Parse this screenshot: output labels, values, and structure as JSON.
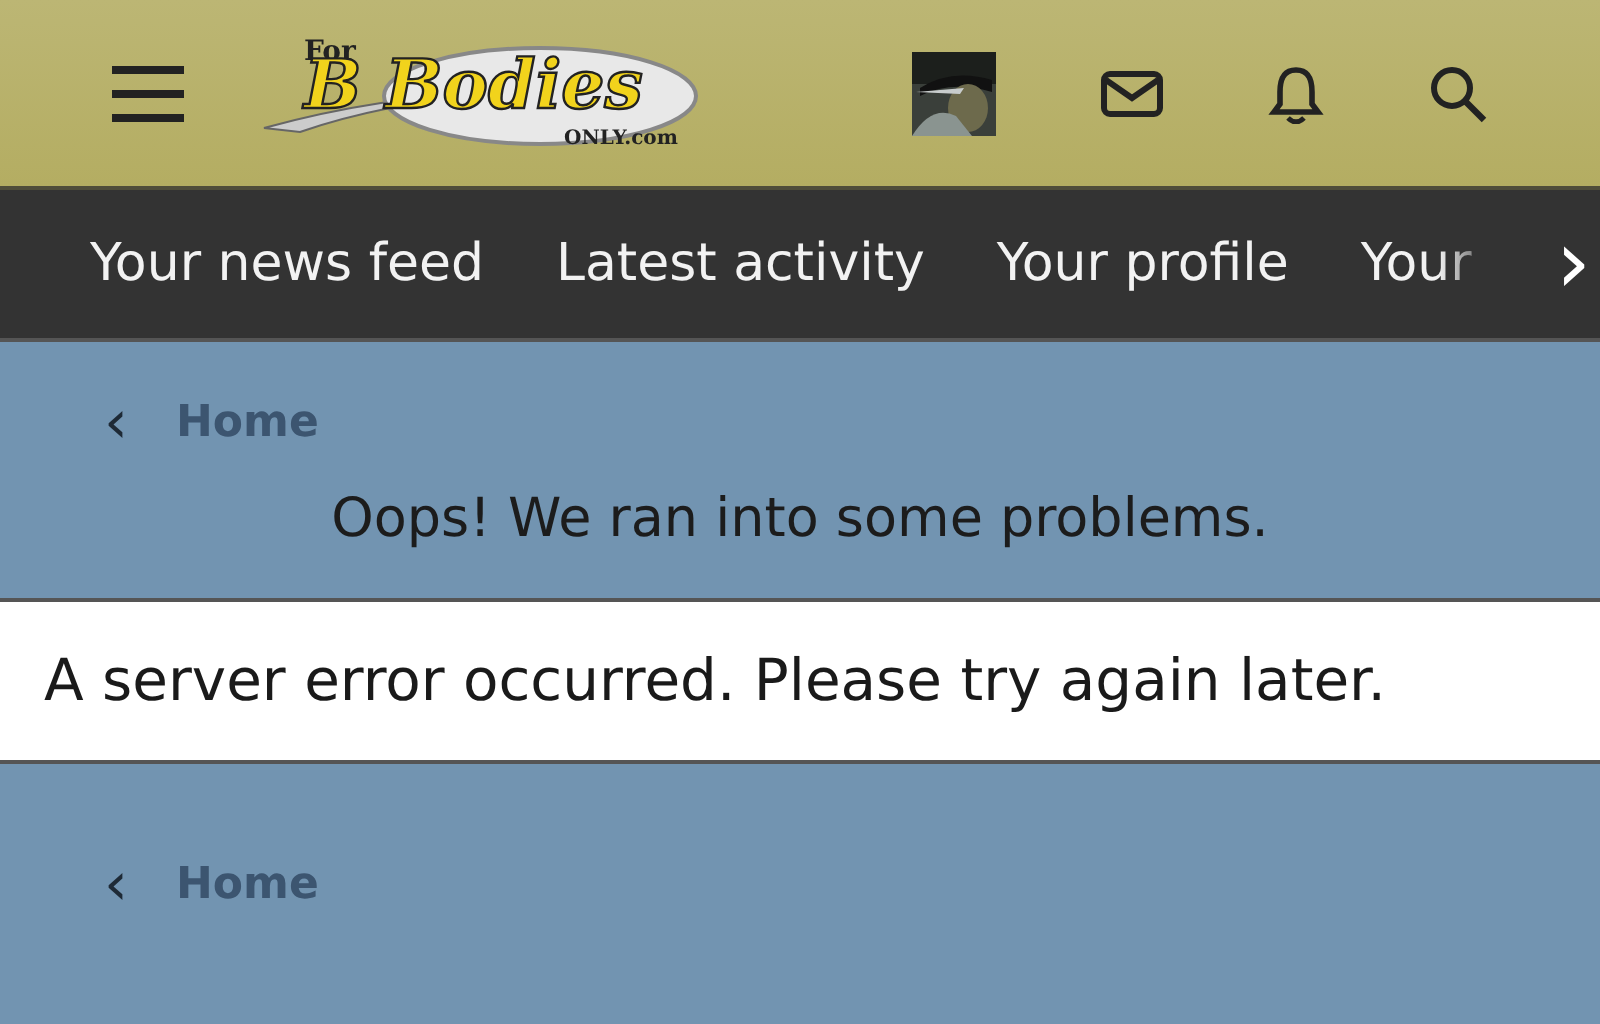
{
  "header": {
    "logo": {
      "top": "For",
      "main": "B Bodies",
      "bottom": "ONLY.com"
    }
  },
  "nav": {
    "items": [
      {
        "label": "Your news feed"
      },
      {
        "label": "Latest activity"
      },
      {
        "label": "Your profile"
      },
      {
        "label": "Your"
      }
    ],
    "next": "›"
  },
  "breadcrumb_top": {
    "back": "‹",
    "label": "Home"
  },
  "title": "Oops! We ran into some problems.",
  "error": "A server error occurred. Please try again later.",
  "breadcrumb_bottom": {
    "back": "‹",
    "label": "Home"
  }
}
